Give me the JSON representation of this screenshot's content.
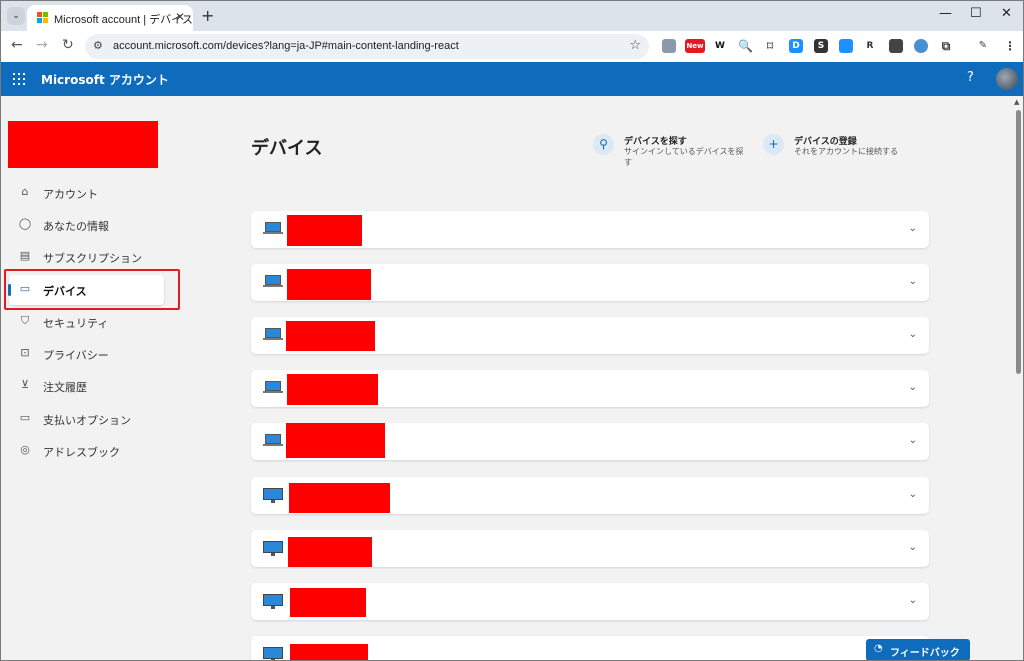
{
  "browser": {
    "tab_title": "Microsoft account | デバイス",
    "url": "account.microsoft.com/devices?lang=ja-JP#main-content-landing-react",
    "extension_new_badge": "New",
    "extension_w": "W"
  },
  "header": {
    "title": "Microsoft アカウント",
    "help": "?"
  },
  "sidebar": {
    "items": [
      {
        "label": "アカウント",
        "icon": "home-icon"
      },
      {
        "label": "あなたの情報",
        "icon": "person-icon"
      },
      {
        "label": "サブスクリプション",
        "icon": "subscription-icon"
      },
      {
        "label": "デバイス",
        "icon": "monitor-icon",
        "active": true
      },
      {
        "label": "セキュリティ",
        "icon": "shield-icon"
      },
      {
        "label": "プライバシー",
        "icon": "lock-icon"
      },
      {
        "label": "注文履歴",
        "icon": "cart-icon"
      },
      {
        "label": "支払いオプション",
        "icon": "card-icon"
      },
      {
        "label": "アドレスブック",
        "icon": "location-icon"
      }
    ]
  },
  "main": {
    "title": "デバイス",
    "actions": [
      {
        "title": "デバイスを探す",
        "description": "サインインしているデバイスを探す",
        "icon": "find-device-icon"
      },
      {
        "title": "デバイスの登録",
        "description": "それをアカウントに接続する",
        "icon": "plus-icon"
      }
    ],
    "devices": [
      {
        "type": "laptop"
      },
      {
        "type": "laptop"
      },
      {
        "type": "laptop"
      },
      {
        "type": "laptop"
      },
      {
        "type": "laptop"
      },
      {
        "type": "desktop"
      },
      {
        "type": "desktop"
      },
      {
        "type": "desktop"
      },
      {
        "type": "desktop"
      }
    ]
  },
  "feedback": {
    "label": "フィードバック"
  },
  "colors": {
    "brand": "#0f6cbd",
    "redaction": "#ff0000",
    "highlight": "#e01b24"
  }
}
